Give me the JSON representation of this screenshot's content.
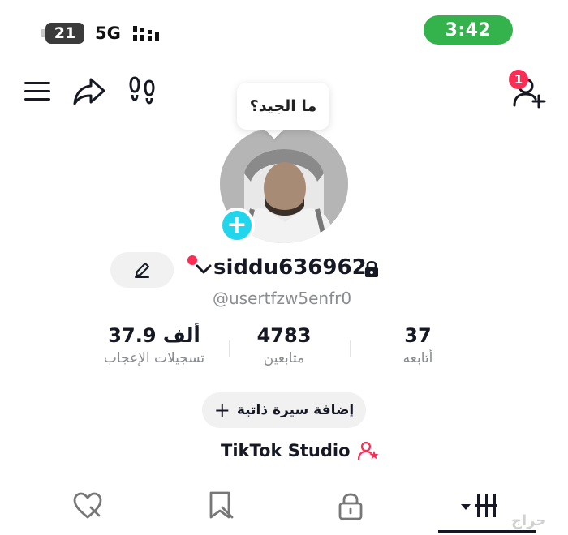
{
  "status_bar": {
    "battery_level": "21",
    "network": "5G",
    "time": "3:42"
  },
  "header": {
    "notification_count": "1"
  },
  "profile": {
    "bubble_text": "ما الجيد؟",
    "username": "siddu636962",
    "handle": "@usertfzw5enfr0"
  },
  "stats": {
    "likes": {
      "value": "37.9 ألف",
      "label": "تسجيلات الإعجاب"
    },
    "followers": {
      "value": "4783",
      "label": "متابعين"
    },
    "following": {
      "value": "37",
      "label": "أتابعه"
    }
  },
  "bio_button": {
    "plus": "+",
    "label": "إضافة سيرة ذاتية"
  },
  "studio": {
    "label": "TikTok Studio"
  },
  "watermark": "حراج",
  "colors": {
    "time_pill": "#34b34c",
    "accent_red": "#fe2c55",
    "add_photo": "#20d5ec",
    "text_primary": "#161823",
    "text_secondary": "#8a8b91"
  },
  "icons": [
    "menu-icon",
    "share-icon",
    "footprint-icon",
    "add-friend-icon",
    "edit-pencil-icon",
    "lock-icon",
    "studio-person-icon",
    "liked-heart-icon",
    "favorites-icon",
    "private-lock-icon",
    "videos-grid-icon"
  ]
}
